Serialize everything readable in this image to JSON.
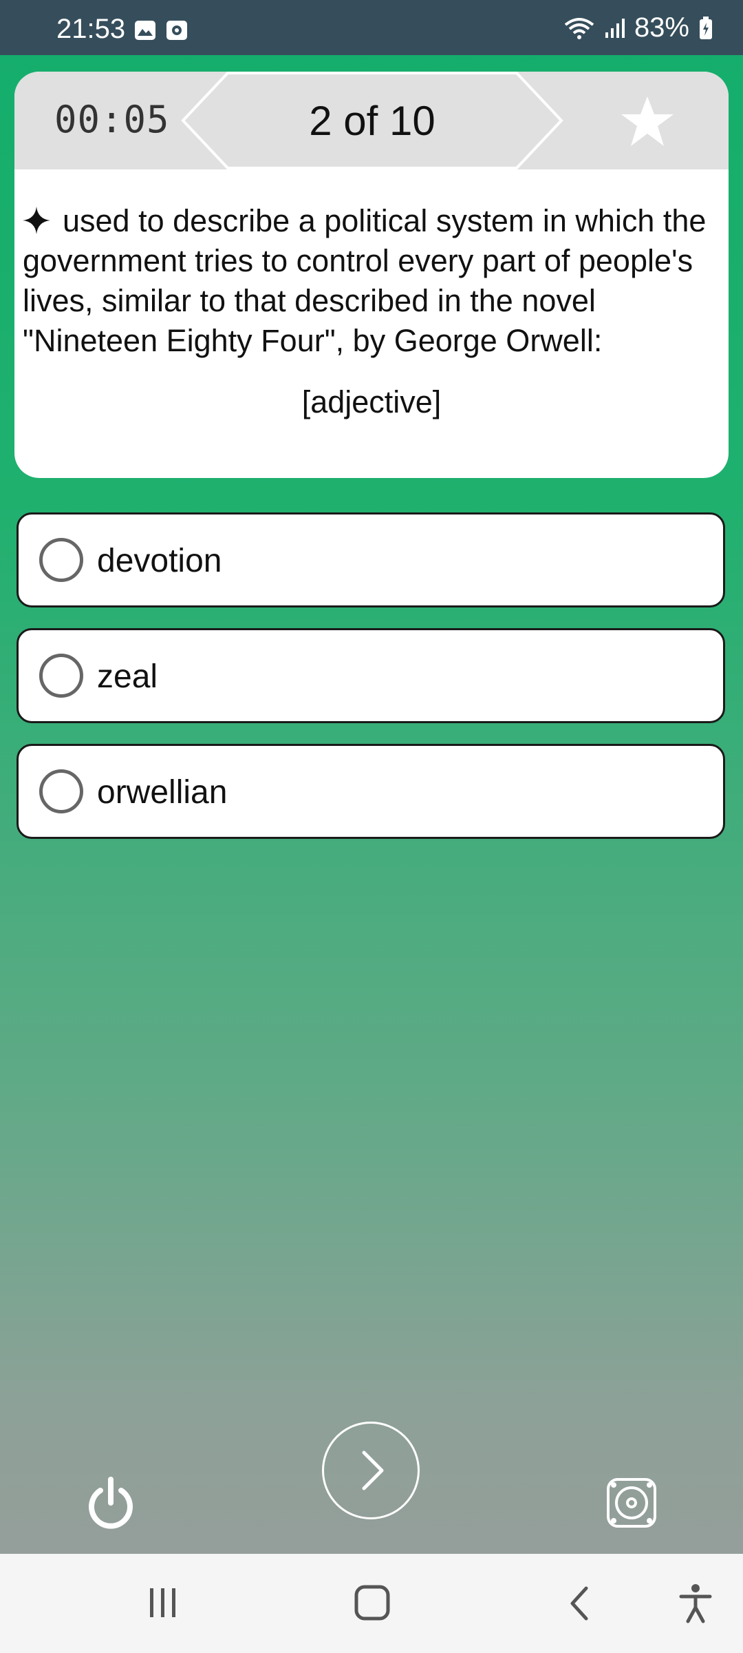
{
  "status": {
    "time": "21:53",
    "battery": "83%"
  },
  "quiz": {
    "timer": "00:05",
    "counter": "2 of 10",
    "question": "used to describe a political system in which the government tries to control every part of people's lives, similar to that described in the novel \"Nineteen Eighty Four\", by George Orwell:",
    "part_of_speech": "[adjective]",
    "options": [
      {
        "label": "devotion"
      },
      {
        "label": "zeal"
      },
      {
        "label": "orwellian"
      }
    ]
  },
  "icons": {
    "star": "star-icon",
    "next": "chevron-right-icon",
    "power": "power-icon",
    "speaker": "speaker-icon"
  },
  "colors": {
    "statusbar": "#364e5b",
    "gradient_top": "#14ad6b",
    "gradient_bottom": "#9a9c9b",
    "card_header": "#e0e0e0"
  }
}
